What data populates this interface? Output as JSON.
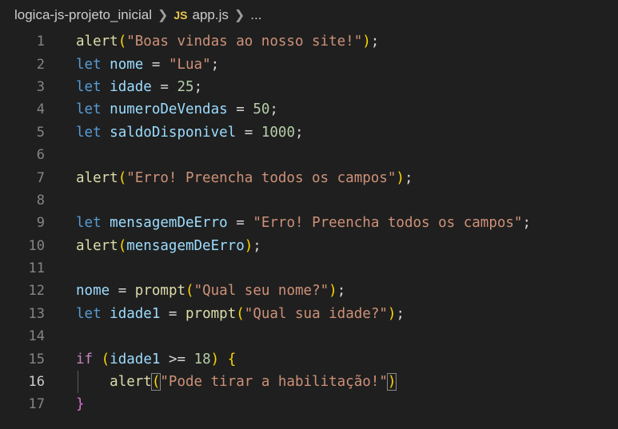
{
  "breadcrumb": {
    "folder": "logica-js-projeto_inicial",
    "file_icon_label": "JS",
    "file": "app.js",
    "more": "..."
  },
  "editor": {
    "active_line": 16,
    "lines": [
      {
        "n": "1",
        "text": "alert(\"Boas vindas ao nosso site!\");"
      },
      {
        "n": "2",
        "text": "let nome = \"Lua\";"
      },
      {
        "n": "3",
        "text": "let idade = 25;"
      },
      {
        "n": "4",
        "text": "let numeroDeVendas = 50;"
      },
      {
        "n": "5",
        "text": "let saldoDisponivel = 1000;"
      },
      {
        "n": "6",
        "text": ""
      },
      {
        "n": "7",
        "text": "alert(\"Erro! Preencha todos os campos\");"
      },
      {
        "n": "8",
        "text": ""
      },
      {
        "n": "9",
        "text": "let mensagemDeErro = \"Erro! Preencha todos os campos\";"
      },
      {
        "n": "10",
        "text": "alert(mensagemDeErro);"
      },
      {
        "n": "11",
        "text": ""
      },
      {
        "n": "12",
        "text": "nome = prompt(\"Qual seu nome?\");"
      },
      {
        "n": "13",
        "text": "let idade1 = prompt(\"Qual sua idade?\");"
      },
      {
        "n": "14",
        "text": ""
      },
      {
        "n": "15",
        "text": "if (idade1 >= 18) {"
      },
      {
        "n": "16",
        "text": "    alert(\"Pode tirar a habilitação!\")"
      },
      {
        "n": "17",
        "text": "}"
      }
    ]
  }
}
